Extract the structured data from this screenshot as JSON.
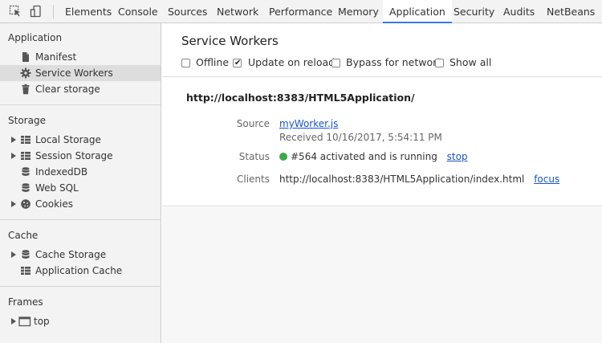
{
  "toolbar": {
    "tabs": [
      {
        "label": "Elements"
      },
      {
        "label": "Console"
      },
      {
        "label": "Sources"
      },
      {
        "label": "Network"
      },
      {
        "label": "Performance"
      },
      {
        "label": "Memory"
      },
      {
        "label": "Application"
      },
      {
        "label": "Security"
      },
      {
        "label": "Audits"
      },
      {
        "label": "NetBeans"
      }
    ],
    "active_tab": "Application",
    "accent_color": "#3879d9"
  },
  "sidebar": {
    "application": {
      "title": "Application",
      "items": [
        {
          "label": "Manifest",
          "icon": "file-icon"
        },
        {
          "label": "Service Workers",
          "icon": "gear-icon"
        },
        {
          "label": "Clear storage",
          "icon": "trash-icon"
        }
      ]
    },
    "storage": {
      "title": "Storage",
      "items": [
        {
          "label": "Local Storage",
          "icon": "grid-icon"
        },
        {
          "label": "Session Storage",
          "icon": "grid-icon"
        },
        {
          "label": "IndexedDB",
          "icon": "database-icon"
        },
        {
          "label": "Web SQL",
          "icon": "database-icon"
        },
        {
          "label": "Cookies",
          "icon": "cookie-icon"
        }
      ]
    },
    "cache": {
      "title": "Cache",
      "items": [
        {
          "label": "Cache Storage",
          "icon": "database-icon"
        },
        {
          "label": "Application Cache",
          "icon": "grid-icon"
        }
      ]
    },
    "frames": {
      "title": "Frames",
      "items": [
        {
          "label": "top",
          "icon": "frame-icon"
        }
      ]
    },
    "selected_item": "Service Workers"
  },
  "main": {
    "title": "Service Workers",
    "options": [
      {
        "label": "Offline",
        "checked": false
      },
      {
        "label": "Update on reload",
        "checked": true
      },
      {
        "label": "Bypass for network",
        "checked": false
      },
      {
        "label": "Show all",
        "checked": false
      }
    ],
    "worker": {
      "origin": "http://localhost:8383/HTML5Application/",
      "source_label": "Source",
      "source_link": "myWorker.js",
      "received": "Received 10/16/2017, 5:54:11 PM",
      "status_label": "Status",
      "status_text": "#564 activated and is running",
      "status_action": "stop",
      "status_color": "#3da84b",
      "clients_label": "Clients",
      "client_url": "http://localhost:8383/HTML5Application/index.html",
      "client_action": "focus"
    }
  }
}
